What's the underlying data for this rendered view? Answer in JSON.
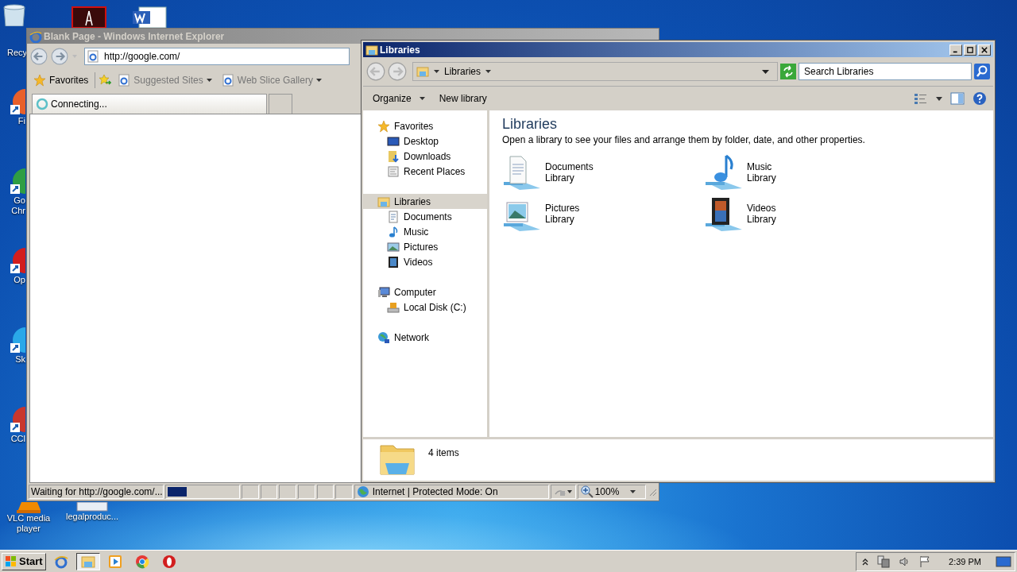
{
  "desktop_icons": [
    {
      "kind": "recycle",
      "lines": [
        "Recy"
      ]
    },
    {
      "kind": "firefox",
      "lines": [
        "Fi"
      ]
    },
    {
      "kind": "chrome",
      "lines": [
        "Go",
        "Chr"
      ]
    },
    {
      "kind": "opera",
      "lines": [
        "Op"
      ]
    },
    {
      "kind": "skype",
      "lines": [
        "Sk"
      ]
    },
    {
      "kind": "ccleaner",
      "lines": [
        "CCl"
      ]
    },
    {
      "kind": "vlc",
      "lines": [
        "VLC media",
        "player"
      ]
    },
    {
      "kind": "document",
      "lines": [
        "legalproduc..."
      ]
    }
  ],
  "ie_window": {
    "title": "Blank Page - Windows Internet Explorer",
    "address": "http://google.com/",
    "favorites_bar": {
      "favorites": "Favorites",
      "links": [
        "Suggested Sites",
        "Web Slice Gallery"
      ]
    },
    "tab": {
      "label": "Connecting..."
    },
    "status_bar": {
      "text": "Waiting for http://google.com/...",
      "progress": {
        "level": 0.27
      },
      "zone": "Internet | Protected Mode: On",
      "zoom": "100%"
    }
  },
  "explorer_window": {
    "title": "Libraries",
    "breadcrumb": "Libraries",
    "search": {
      "placeholder": "Search Libraries"
    },
    "toolbar": [
      "Organize",
      "New library"
    ],
    "nav_pane": [
      {
        "label": "Favorites",
        "selected": false,
        "children": [
          {
            "label": "Desktop",
            "selected": false
          },
          {
            "label": "Downloads",
            "selected": false
          },
          {
            "label": "Recent Places",
            "selected": false
          }
        ]
      },
      {
        "label": "Libraries",
        "selected": true,
        "children": [
          {
            "label": "Documents",
            "selected": false
          },
          {
            "label": "Music",
            "selected": false
          },
          {
            "label": "Pictures",
            "selected": false
          },
          {
            "label": "Videos",
            "selected": false
          }
        ]
      },
      {
        "label": "Computer",
        "selected": false,
        "children": [
          {
            "label": "Local Disk (C:)",
            "selected": false
          }
        ]
      },
      {
        "label": "Network",
        "selected": false
      }
    ],
    "heading": "Libraries",
    "description": "Open a library to see your files and arrange them by folder, date, and other properties.",
    "libraries": [
      {
        "kind": "documents",
        "name": "Documents",
        "subtitle": "Library"
      },
      {
        "kind": "music",
        "name": "Music",
        "subtitle": "Library"
      },
      {
        "kind": "pictures",
        "name": "Pictures",
        "subtitle": "Library"
      },
      {
        "kind": "videos",
        "name": "Videos",
        "subtitle": "Library"
      }
    ],
    "details": "4 items"
  },
  "taskbar": {
    "start": "Start",
    "apps": [
      {
        "kind": "ie",
        "selected": false
      },
      {
        "kind": "explorer",
        "selected": true
      },
      {
        "kind": "media",
        "selected": false
      },
      {
        "kind": "chrome",
        "selected": false
      },
      {
        "kind": "opera",
        "selected": false
      }
    ],
    "clock": "2:39 PM"
  }
}
